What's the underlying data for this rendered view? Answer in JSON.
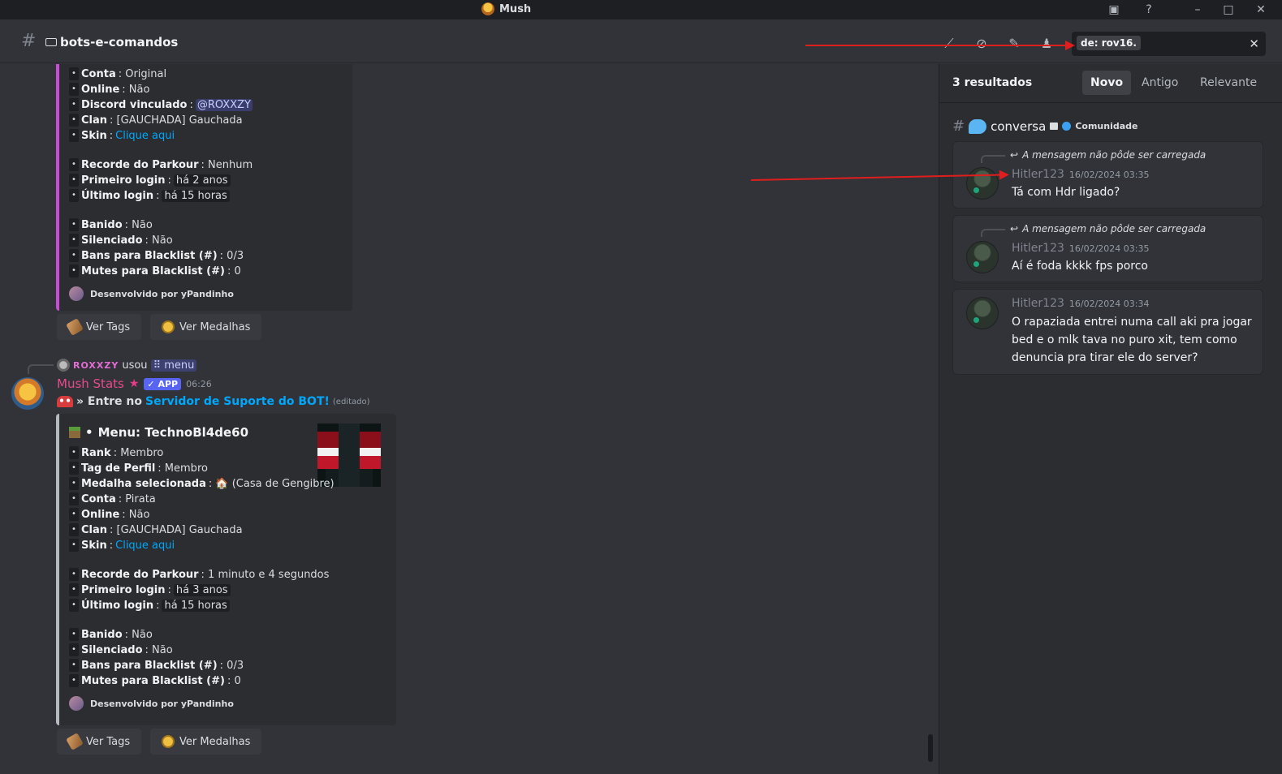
{
  "window": {
    "title": "Mush"
  },
  "header": {
    "channel_name": "bots-e-comandos",
    "search_token": "de:  rov16."
  },
  "embed1": {
    "fields": [
      {
        "label": "Conta",
        "value": ": Original"
      },
      {
        "label": "Online",
        "value": ": Não"
      },
      {
        "label": "Discord vinculado",
        "value": ": ",
        "mention": "@ROXXZY"
      },
      {
        "label": "Clan",
        "value": ": [GAUCHADA] Gauchada"
      },
      {
        "label": "Skin",
        "value": ": ",
        "link": "Clique aqui"
      },
      {
        "label": "Recorde do Parkour",
        "value": ": Nenhum"
      },
      {
        "label": "Primeiro login",
        "value": ": ",
        "chip": "há 2 anos"
      },
      {
        "label": "Último login",
        "value": ": ",
        "chip": "há 15 horas"
      },
      {
        "label": "Banido",
        "value": ": Não"
      },
      {
        "label": "Silenciado",
        "value": ": Não"
      },
      {
        "label": "Bans para Blacklist (#)",
        "value": ": 0/3"
      },
      {
        "label": "Mutes para Blacklist (#)",
        "value": ": 0"
      }
    ],
    "footer": "Desenvolvido por yPandinho",
    "accent": "#c94bd6"
  },
  "buttons": {
    "tags": "Ver Tags",
    "medals": "Ver Medalhas"
  },
  "message2": {
    "reply_user": "ROXXZY",
    "reply_used": "usou",
    "reply_command": "menu",
    "author": "Mush Stats",
    "app_badge": "✓ APP",
    "time": "06:26",
    "text_prefix": "» Entre no",
    "text_link": "Servidor de Suporte do BOT!",
    "edited": "(editado)"
  },
  "embed2": {
    "title_prefix": "•",
    "title": "Menu: TechnoBl4de60",
    "fields": [
      {
        "label": "Rank",
        "value": ": Membro"
      },
      {
        "label": "Tag de Perfil",
        "value": ": Membro"
      },
      {
        "label": "Medalha selecionada",
        "value": ": 🏠 (Casa de Gengibre)"
      },
      {
        "label": "Conta",
        "value": ": Pirata"
      },
      {
        "label": "Online",
        "value": ": Não"
      },
      {
        "label": "Clan",
        "value": ": [GAUCHADA] Gauchada"
      },
      {
        "label": "Skin",
        "value": ": ",
        "link": "Clique aqui"
      },
      {
        "label": "Recorde do Parkour",
        "value": ": 1 minuto e 4 segundos"
      },
      {
        "label": "Primeiro login",
        "value": ": ",
        "chip": "há 3 anos"
      },
      {
        "label": "Último login",
        "value": ": ",
        "chip": "há 15 horas"
      },
      {
        "label": "Banido",
        "value": ": Não"
      },
      {
        "label": "Silenciado",
        "value": ": Não"
      },
      {
        "label": "Bans para Blacklist (#)",
        "value": ": 0/3"
      },
      {
        "label": "Mutes para Blacklist (#)",
        "value": ": 0"
      }
    ],
    "footer": "Desenvolvido por yPandinho",
    "accent": "#b5bac1"
  },
  "results": {
    "count": "3 resultados",
    "sort": [
      "Novo",
      "Antigo",
      "Relevante"
    ],
    "channel": "conversa",
    "community": "Comunidade",
    "reply_note": "A mensagem não pôde ser carregada",
    "items": [
      {
        "user": "Hitler123",
        "time": "16/02/2024 03:35",
        "text": "Tá com Hdr ligado?"
      },
      {
        "user": "Hitler123",
        "time": "16/02/2024 03:35",
        "text": "Aí é foda kkkk fps porco"
      },
      {
        "user": "Hitler123",
        "time": "16/02/2024 03:34",
        "text": "O rapaziada entrei numa call aki pra jogar bed e o mlk tava no puro xit, tem como denuncia pra tirar ele do server?"
      }
    ]
  }
}
